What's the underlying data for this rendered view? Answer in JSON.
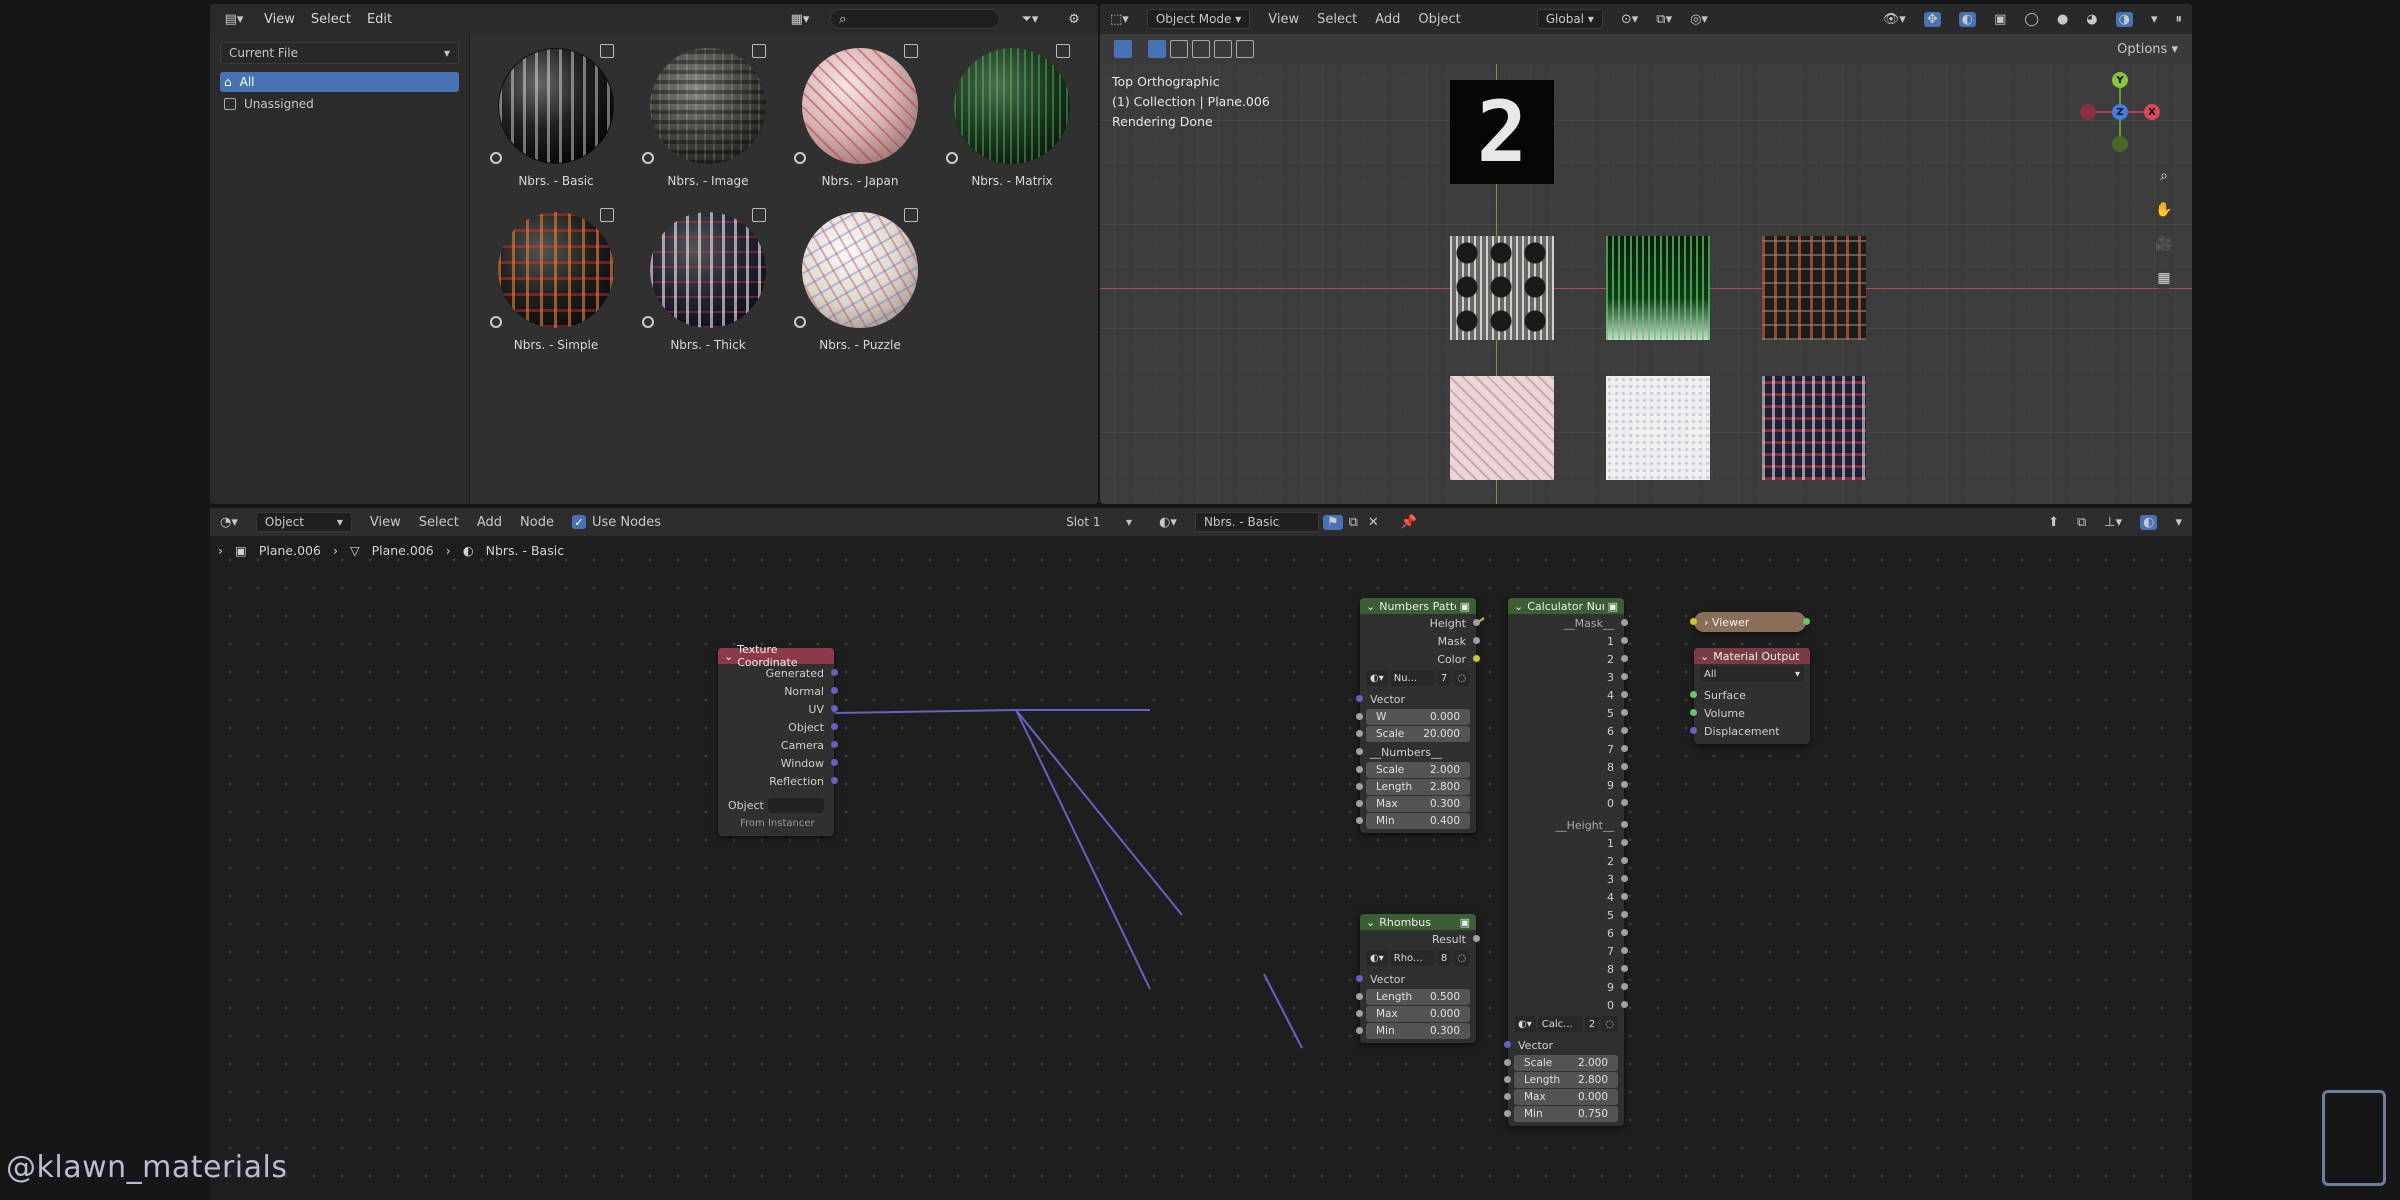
{
  "asset_browser": {
    "menu": [
      "View",
      "Select",
      "Edit"
    ],
    "library": "Current File",
    "catalogs": [
      {
        "label": "All",
        "active": true
      },
      {
        "label": "Unassigned",
        "active": false
      }
    ],
    "assets": [
      {
        "label": "Nbrs. - Basic",
        "style": "basic"
      },
      {
        "label": "Nbrs. - Image",
        "style": "image"
      },
      {
        "label": "Nbrs. - Japan",
        "style": "japan"
      },
      {
        "label": "Nbrs. - Matrix",
        "style": "matrix"
      },
      {
        "label": "Nbrs. - Simple",
        "style": "simple"
      },
      {
        "label": "Nbrs. - Thick",
        "style": "thick"
      },
      {
        "label": "Nbrs. - Puzzle",
        "style": "puzzle"
      }
    ]
  },
  "viewport": {
    "mode": "Object Mode",
    "menu": [
      "View",
      "Select",
      "Add",
      "Object"
    ],
    "transform": "Global",
    "options": "Options",
    "info": [
      "Top Orthographic",
      "(1) Collection | Plane.006",
      "Rendering Done"
    ],
    "digit": "2",
    "gizmo": {
      "x": "X",
      "y": "Y",
      "z": "Z"
    }
  },
  "node_editor": {
    "editor_type": "Object",
    "menu": [
      "View",
      "Select",
      "Add",
      "Node"
    ],
    "use_nodes": "Use Nodes",
    "slot": "Slot 1",
    "material": "Nbrs. - Basic",
    "breadcrumb": [
      "Plane.006",
      "Plane.006",
      "Nbrs. - Basic"
    ]
  },
  "nodes": {
    "tex_coord": {
      "title": "Texture Coordinate",
      "outputs": [
        "Generated",
        "Normal",
        "UV",
        "Object",
        "Camera",
        "Window",
        "Reflection"
      ],
      "object_label": "Object",
      "from_instancer": "From Instancer"
    },
    "numbers": {
      "title": "Numbers Pattern",
      "outputs": [
        "Height",
        "Mask",
        "Color"
      ],
      "group": "Nu...",
      "users": "7",
      "vector": "Vector",
      "fields": [
        {
          "k": "W",
          "v": "0.000"
        },
        {
          "k": "Scale",
          "v": "20.000"
        }
      ],
      "section": "__Numbers__",
      "fields2": [
        {
          "k": "Scale",
          "v": "2.000"
        },
        {
          "k": "Length",
          "v": "2.800"
        },
        {
          "k": "Max",
          "v": "0.300"
        },
        {
          "k": "Min",
          "v": "0.400"
        }
      ]
    },
    "rhombus": {
      "title": "Rhombus",
      "output": "Result",
      "group": "Rho...",
      "users": "8",
      "vector": "Vector",
      "fields": [
        {
          "k": "Length",
          "v": "0.500"
        },
        {
          "k": "Max",
          "v": "0.000"
        },
        {
          "k": "Min",
          "v": "0.300"
        }
      ]
    },
    "calculator": {
      "title": "Calculator Numbers",
      "mask_label": "__Mask__",
      "mask_outputs": [
        "1",
        "2",
        "3",
        "4",
        "5",
        "6",
        "7",
        "8",
        "9",
        "0"
      ],
      "height_label": "__Height__",
      "height_outputs": [
        "1",
        "2",
        "3",
        "4",
        "5",
        "6",
        "7",
        "8",
        "9",
        "0"
      ],
      "group": "Calc...",
      "users": "2",
      "vector": "Vector",
      "fields": [
        {
          "k": "Scale",
          "v": "2.000"
        },
        {
          "k": "Length",
          "v": "2.800"
        },
        {
          "k": "Max",
          "v": "0.000"
        },
        {
          "k": "Min",
          "v": "0.750"
        }
      ]
    },
    "viewer": {
      "title": "Viewer"
    },
    "output": {
      "title": "Material Output",
      "target": "All",
      "inputs": [
        "Surface",
        "Volume",
        "Displacement"
      ]
    }
  },
  "watermark": "@klawn_materials",
  "colors": {
    "accent": "#4772b3",
    "tex_header": "#8b3a4d",
    "group_header": "#3b5e35",
    "output_header": "#7a3b44",
    "vector_socket": "#6363c7"
  }
}
